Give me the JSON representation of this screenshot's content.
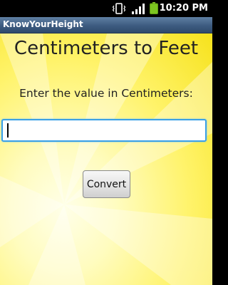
{
  "status_bar": {
    "time": "10:20 PM",
    "icons": [
      "vibrate-icon",
      "signal-icon",
      "battery-icon"
    ]
  },
  "app": {
    "title": "KnowYourHeight"
  },
  "main": {
    "heading": "Centimeters to Feet",
    "prompt": "Enter the value in Centimeters:",
    "input_value": "",
    "input_placeholder": "",
    "convert_label": "Convert"
  },
  "colors": {
    "title_bar": "#3d5b80",
    "background": "#fff36a",
    "input_focus": "#3aa0e6"
  }
}
